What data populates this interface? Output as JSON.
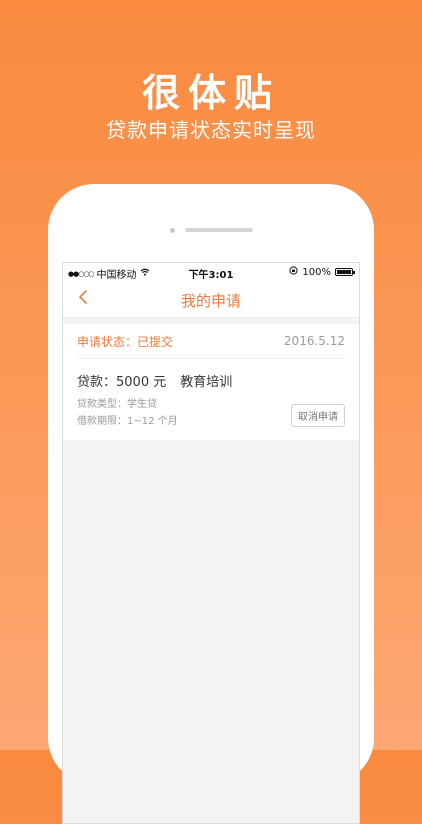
{
  "promo": {
    "headline": "很体贴",
    "subline": "贷款申请状态实时呈现"
  },
  "statusbar": {
    "signal": "●●○○○",
    "carrier": "中国移动",
    "time": "下午3:01",
    "battery": "100%",
    "battery_level": 1.0
  },
  "navbar": {
    "back_icon": "chevron-left-icon",
    "title": "我的申请"
  },
  "application": {
    "status": "申请状态：已提交",
    "date": "2016.5.12",
    "loan_amount": "贷款：5000 元",
    "loan_purpose": "教育培训",
    "loan_type": "贷款类型：学生贷",
    "loan_term": "借款期限：1~12 个月",
    "cancel_label": "取消申请"
  },
  "colors": {
    "accent": "#f07b3e",
    "background_top": "#f98a3e",
    "background_bottom": "#fda874"
  }
}
